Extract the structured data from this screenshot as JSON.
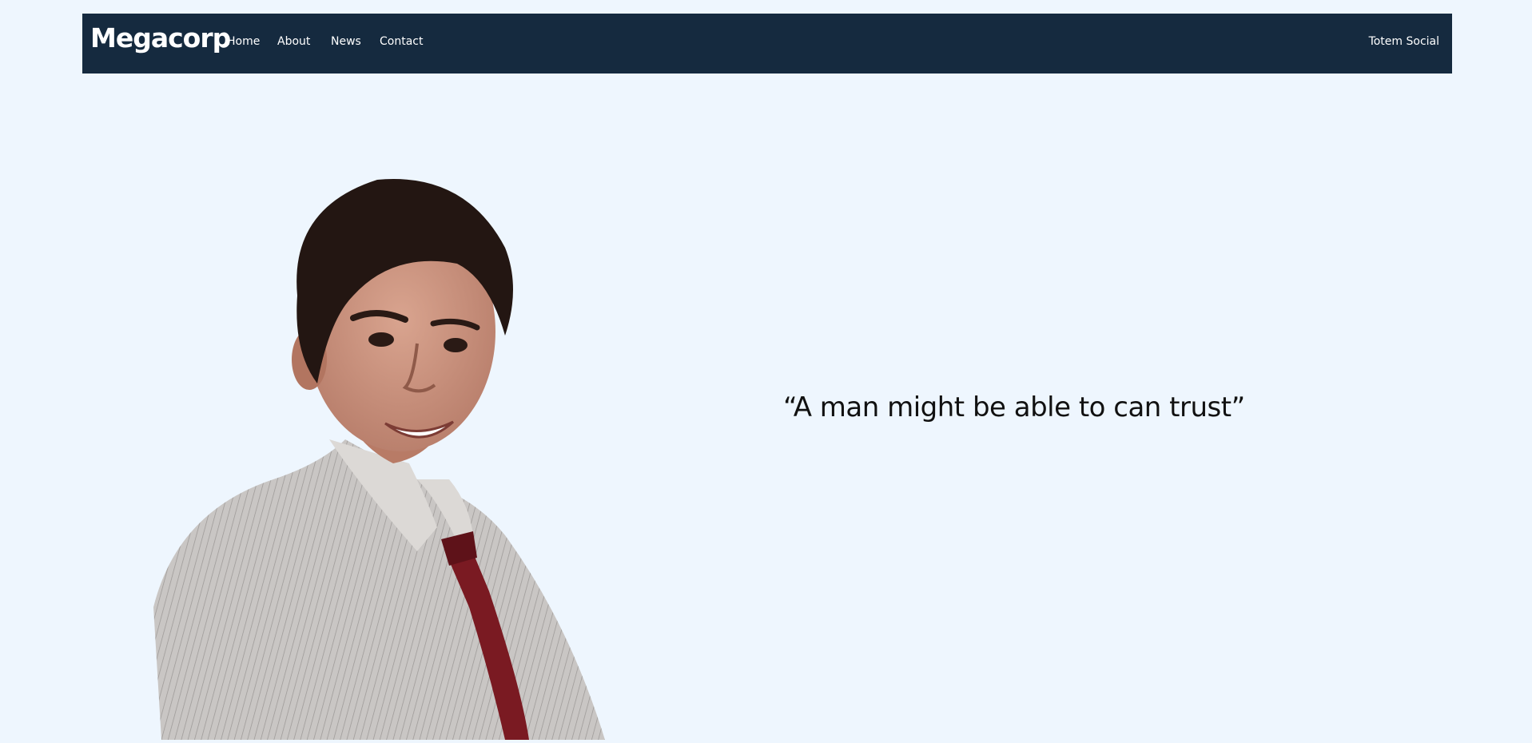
{
  "navbar": {
    "brand": "Megacorp",
    "links": [
      {
        "label": "Home"
      },
      {
        "label": "About"
      },
      {
        "label": "News"
      },
      {
        "label": "Contact"
      }
    ],
    "right_link": "Totem Social",
    "background": "#152a3f"
  },
  "hero": {
    "quote": "“A man might be able to can trust”",
    "portrait_alt": "Portrait of a young man in a striped shirt and dark red tie"
  },
  "colors": {
    "page_background": "#eef6fe",
    "nav_text": "#ffffff",
    "quote_text": "#111111",
    "tie": "#7a1a22"
  }
}
